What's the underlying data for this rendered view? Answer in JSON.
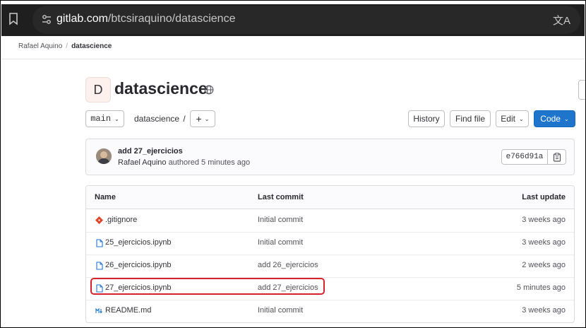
{
  "browser": {
    "url_host": "gitlab.com",
    "url_path": "/btcsiraquino/datascience"
  },
  "breadcrumb": {
    "owner": "Rafael Aquino",
    "separator": "/",
    "project": "datascience"
  },
  "project": {
    "avatar_letter": "D",
    "name": "datascience"
  },
  "toolbar": {
    "branch": "main",
    "path": "datascience",
    "path_sep": "/",
    "add_label": "+",
    "history": "History",
    "find_file": "Find file",
    "edit": "Edit",
    "code": "Code"
  },
  "commit": {
    "message": "add 27_ejercicios",
    "author": "Rafael Aquino",
    "authored": "authored 5 minutes ago",
    "sha": "e766d91a"
  },
  "table": {
    "headers": {
      "name": "Name",
      "last_commit": "Last commit",
      "last_update": "Last update"
    },
    "rows": [
      {
        "name": ".gitignore",
        "icon": "git-icon",
        "commit": "Initial commit",
        "updated": "3 weeks ago"
      },
      {
        "name": "25_ejercicios.ipynb",
        "icon": "file-icon",
        "commit": "Initial commit",
        "updated": "3 weeks ago"
      },
      {
        "name": "26_ejercicios.ipynb",
        "icon": "file-icon",
        "commit": "add 26_ejercicios",
        "updated": "2 weeks ago"
      },
      {
        "name": "27_ejercicios.ipynb",
        "icon": "file-icon",
        "commit": "add 27_ejercicios",
        "updated": "5 minutes ago"
      },
      {
        "name": "README.md",
        "icon": "markdown-icon",
        "commit": "Initial commit",
        "updated": "3 weeks ago"
      }
    ]
  },
  "colors": {
    "accent": "#1f75cb",
    "highlight": "#d6232b",
    "git_icon": "#e24329",
    "file_icon": "#1f75cb"
  }
}
